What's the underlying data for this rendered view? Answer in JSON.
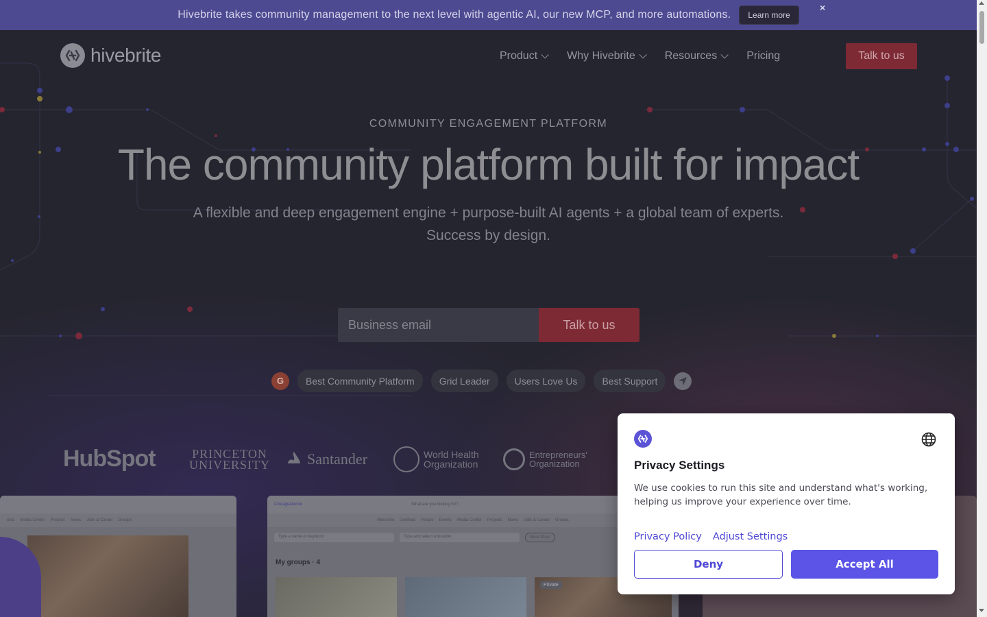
{
  "announcement": {
    "text": "Hivebrite takes community management to the next level with agentic AI, our new MCP, and more automations.",
    "button": "Learn more",
    "close": "×"
  },
  "header": {
    "logo_text": "hivebrite",
    "nav": [
      {
        "label": "Product",
        "dropdown": true
      },
      {
        "label": "Why Hivebrite",
        "dropdown": true
      },
      {
        "label": "Resources",
        "dropdown": true
      },
      {
        "label": "Pricing",
        "dropdown": false
      }
    ],
    "cta": "Talk to us"
  },
  "hero": {
    "eyebrow": "COMMUNITY ENGAGEMENT PLATFORM",
    "headline": "The community platform built for impact",
    "subline_1": "A flexible and deep engagement engine + purpose-built AI agents + a global team of experts.",
    "subline_2": "Success by design.",
    "email_placeholder": "Business email",
    "email_button": "Talk to us"
  },
  "badges": {
    "g2_icon": "g2-icon",
    "items": [
      "Best Community Platform",
      "Grid Leader",
      "Users Love Us",
      "Best Support"
    ],
    "capterra_icon": "capterra-icon"
  },
  "customer_logos": {
    "hubspot": "HubSpot",
    "princeton_1": "PRINCETON",
    "princeton_2": "UNIVERSITY",
    "santander": "Santander",
    "who_1": "World Health",
    "who_2": "Organization",
    "eo_1": "Entrepreneurs'",
    "eo_2": "Organization"
  },
  "screens": {
    "left_nav": [
      "ents",
      "Media Center",
      "Projects",
      "News",
      "Jobs & Career",
      "Groups"
    ],
    "mid_logo": "ChicagoAlumni",
    "mid_search": "What are you looking for?",
    "mid_nav": [
      "Welcome",
      "Livefeed",
      "People",
      "Events",
      "Media Center",
      "Projects",
      "News",
      "Jobs & Career",
      "Groups"
    ],
    "mid_filter_1": "Type a name or keyword",
    "mid_filter_2": "Type and select a location",
    "mid_filter_btn": "More filters",
    "mid_groups_title": "My groups",
    "mid_groups_count": "4",
    "mid_private": "Private"
  },
  "privacy_modal": {
    "title": "Privacy Settings",
    "body": "We use cookies to run this site and understand what's working, helping us improve your experience over time.",
    "links": [
      "Privacy Policy",
      "Adjust Settings"
    ],
    "deny": "Deny",
    "accept": "Accept All",
    "colors": {
      "accent": "#5b54e6",
      "link": "#4e47d4"
    }
  }
}
